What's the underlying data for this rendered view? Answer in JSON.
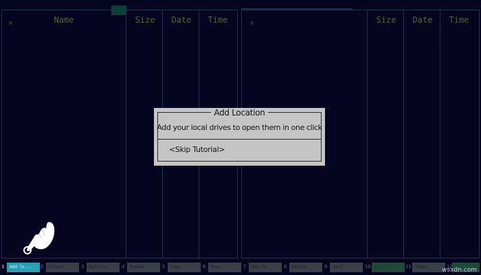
{
  "left_panel": {
    "n_marker": "n",
    "columns": {
      "name": "Name",
      "size": "Size",
      "date": "Date",
      "time": "Time"
    }
  },
  "right_panel": {
    "n_marker": "n",
    "columns": {
      "name": "Name",
      "size": "Size",
      "date": "Date",
      "time": "Time"
    }
  },
  "dialog": {
    "title": "Add Location",
    "message": "Add your local drives to open them in one click",
    "skip_label": "<Skip Tutorial>"
  },
  "function_keys": [
    {
      "num": "1",
      "label": "Add lo..."
    },
    {
      "num": "2",
      "label": "Select"
    },
    {
      "num": "3",
      "label": "Details"
    },
    {
      "num": "4",
      "label": "Rename"
    },
    {
      "num": "5",
      "label": "Copy"
    },
    {
      "num": "6",
      "label": "Move"
    },
    {
      "num": "7",
      "label": "New fo"
    },
    {
      "num": "8",
      "label": "Delete"
    },
    {
      "num": "9",
      "label": "Sort"
    },
    {
      "num": "10",
      "label": "Switch"
    },
    {
      "num": "11",
      "label": "Theme"
    },
    {
      "num": "12",
      "label": ""
    }
  ],
  "watermark": "wsxdn.com",
  "colors": {
    "background": "#05051f",
    "panel_border": "#24314e",
    "header_text": "#59613a",
    "dialog_bg": "#c5c5c5",
    "active_key": "#24a3b5"
  }
}
